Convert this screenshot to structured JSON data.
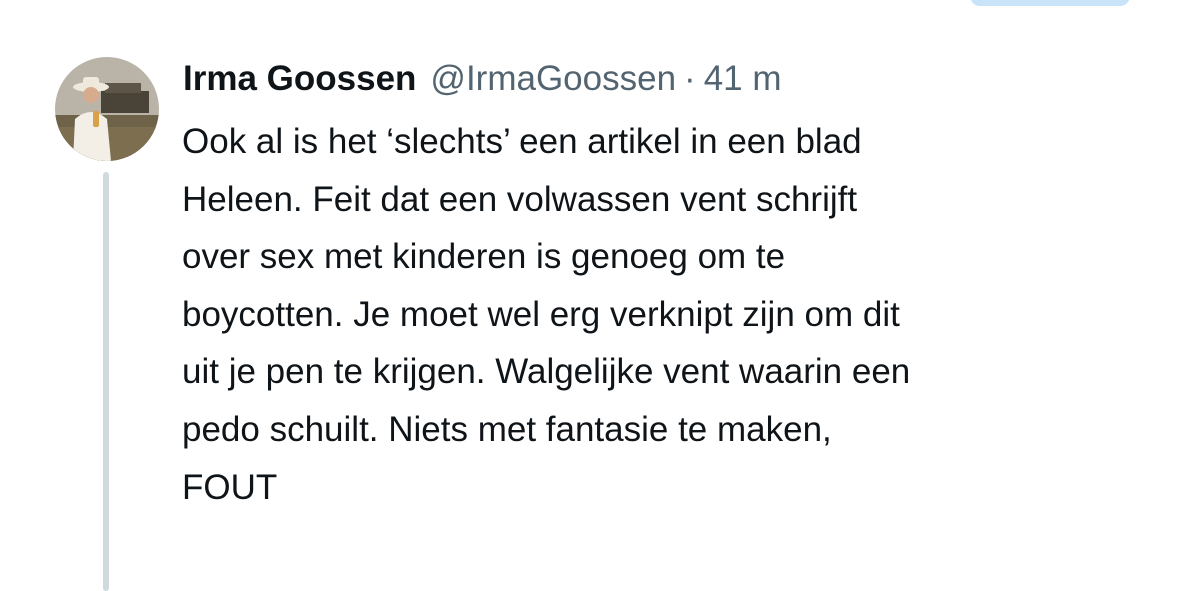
{
  "tweet": {
    "display_name": "Irma Goossen",
    "handle": "@IrmaGoossen",
    "separator": "·",
    "time": "41 m",
    "lines": [
      "Ook al is het ‘slechts’ een artikel in een blad",
      "Heleen. Feit dat een volwassen vent schrijft",
      "over sex met kinderen is genoeg om te",
      "boycotten. Je moet wel erg verknipt zijn om dit",
      "uit je pen te krijgen. Walgelijke vent waarin een",
      "pedo schuilt. Niets met fantasie te maken,",
      "FOUT"
    ]
  },
  "colors": {
    "primary_text": "#0f1419",
    "secondary_text": "#536471",
    "thread_line": "#cfd9de",
    "accent_pill": "#c9e4f8"
  }
}
